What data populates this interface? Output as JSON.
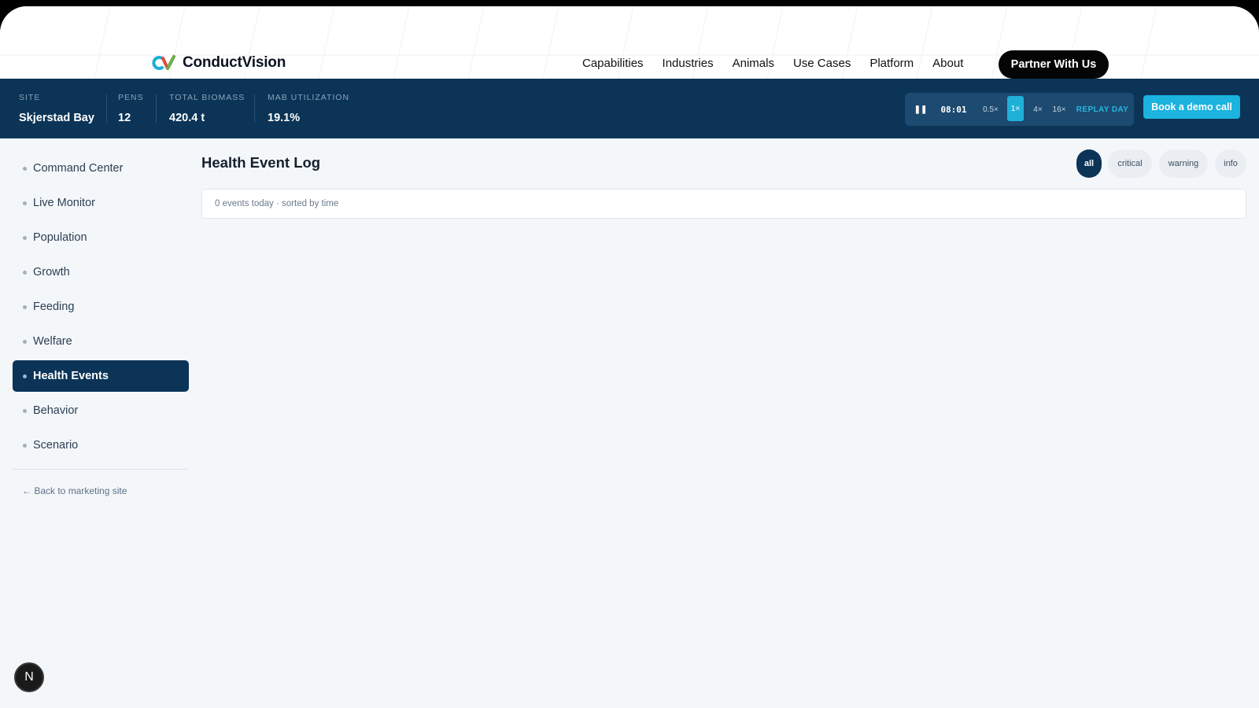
{
  "brand": {
    "name": "ConductVision",
    "logo_icon": "cv-logo-icon"
  },
  "nav": {
    "links": [
      "Capabilities",
      "Industries",
      "Animals",
      "Use Cases",
      "Platform",
      "About"
    ],
    "cta": "Partner With Us"
  },
  "stats": [
    {
      "label": "Site",
      "value": "Skjerstad Bay"
    },
    {
      "label": "Pens",
      "value": "12"
    },
    {
      "label": "Total Biomass",
      "value": "420.4 t"
    },
    {
      "label": "MAB Utilization",
      "value": "19.1%"
    }
  ],
  "playback": {
    "pause_icon": "pause-icon",
    "pause_glyph": "❚❚",
    "time": "08:01",
    "speeds": [
      "0.5×",
      "1×",
      "4×",
      "16×"
    ],
    "active_speed": "1×",
    "replay_label": "REPLAY DAY"
  },
  "demo_button": "Book a demo call",
  "sidebar": {
    "items": [
      {
        "label": "Command Center",
        "active": false
      },
      {
        "label": "Live Monitor",
        "active": false
      },
      {
        "label": "Population",
        "active": false
      },
      {
        "label": "Growth",
        "active": false
      },
      {
        "label": "Feeding",
        "active": false
      },
      {
        "label": "Welfare",
        "active": false
      },
      {
        "label": "Health Events",
        "active": true
      },
      {
        "label": "Behavior",
        "active": false
      },
      {
        "label": "Scenario",
        "active": false
      }
    ],
    "back_link": "← Back to marketing site"
  },
  "main": {
    "title": "Health Event Log",
    "filters": [
      "all",
      "critical",
      "warning",
      "info"
    ],
    "active_filter": "all",
    "summary": "0 events today · sorted by time"
  },
  "badge": {
    "letter": "N"
  },
  "colors": {
    "navy": "#0b3457",
    "accent": "#1cb3df",
    "background": "#f4f7fa"
  }
}
